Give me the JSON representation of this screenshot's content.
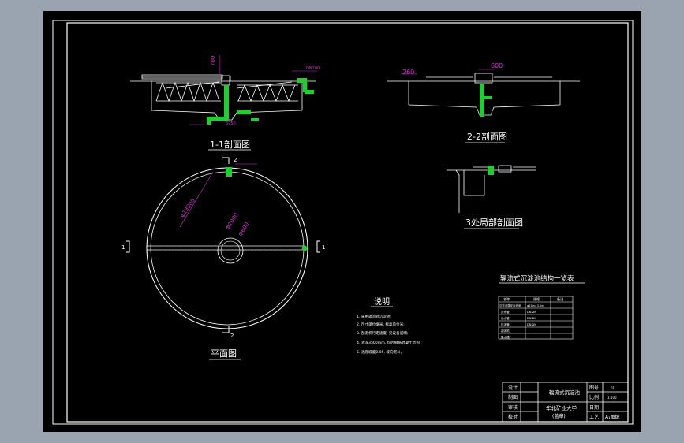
{
  "drawing": {
    "colors": {
      "background": "#000000",
      "frame": "#ffffff",
      "pipe": "#22cc33",
      "dimension": "#d633d6",
      "window_bg": "#9aa3b0"
    },
    "section_1_1": {
      "title": "1-1剖面图",
      "dim_top": "700",
      "dim_bottom": "3750",
      "dim_pipe": "DN200"
    },
    "section_2_2": {
      "title": "2-2剖面图",
      "dim_left": "260",
      "dim_center": "600"
    },
    "detail_3": {
      "title": "3处局部剖面图"
    },
    "plan": {
      "title": "平面图",
      "marker_top": "2",
      "marker_bottom": "2",
      "marker_left": "1",
      "marker_right": "1",
      "dim_outer": "φ13000",
      "dim_mid": "Φ2000",
      "dim_inner": "Φ600"
    },
    "notes": {
      "title": "说明",
      "items": [
        "1. 采用辐流式沉淀池;",
        "2. 尺寸单位毫米, 标高单位米;",
        "3. 刮泥机行走速度, 见设备说明;",
        "4. 池深3500mm, 均为钢筋混凝土结构;",
        "5. 池底坡度0.05, 坡向泥斗。"
      ]
    },
    "param_table": {
      "title": "辐流式沉淀池结构一览表",
      "headers": [
        "名称",
        "规格",
        "备注"
      ],
      "rows": [
        [
          "沉淀池直径及池深",
          "φ13m×3.5m",
          ""
        ],
        [
          "进水管",
          "DN200",
          ""
        ],
        [
          "出水管",
          "DN200",
          ""
        ],
        [
          "排泥管",
          "DN200",
          ""
        ],
        [
          "刮泥机",
          "",
          ""
        ],
        [
          "集水槽",
          "",
          ""
        ]
      ]
    },
    "title_block": {
      "labels": [
        "设计",
        "制图",
        "审核",
        "校对"
      ],
      "drawing_name": "辐流式沉淀池",
      "school": "华北矿业大学",
      "school_sub": "(盖章)",
      "right_labels": [
        "图号",
        "比例",
        "日期",
        "工艺"
      ],
      "right_values": [
        "01",
        "1:100",
        "",
        "A₁图纸"
      ]
    }
  }
}
